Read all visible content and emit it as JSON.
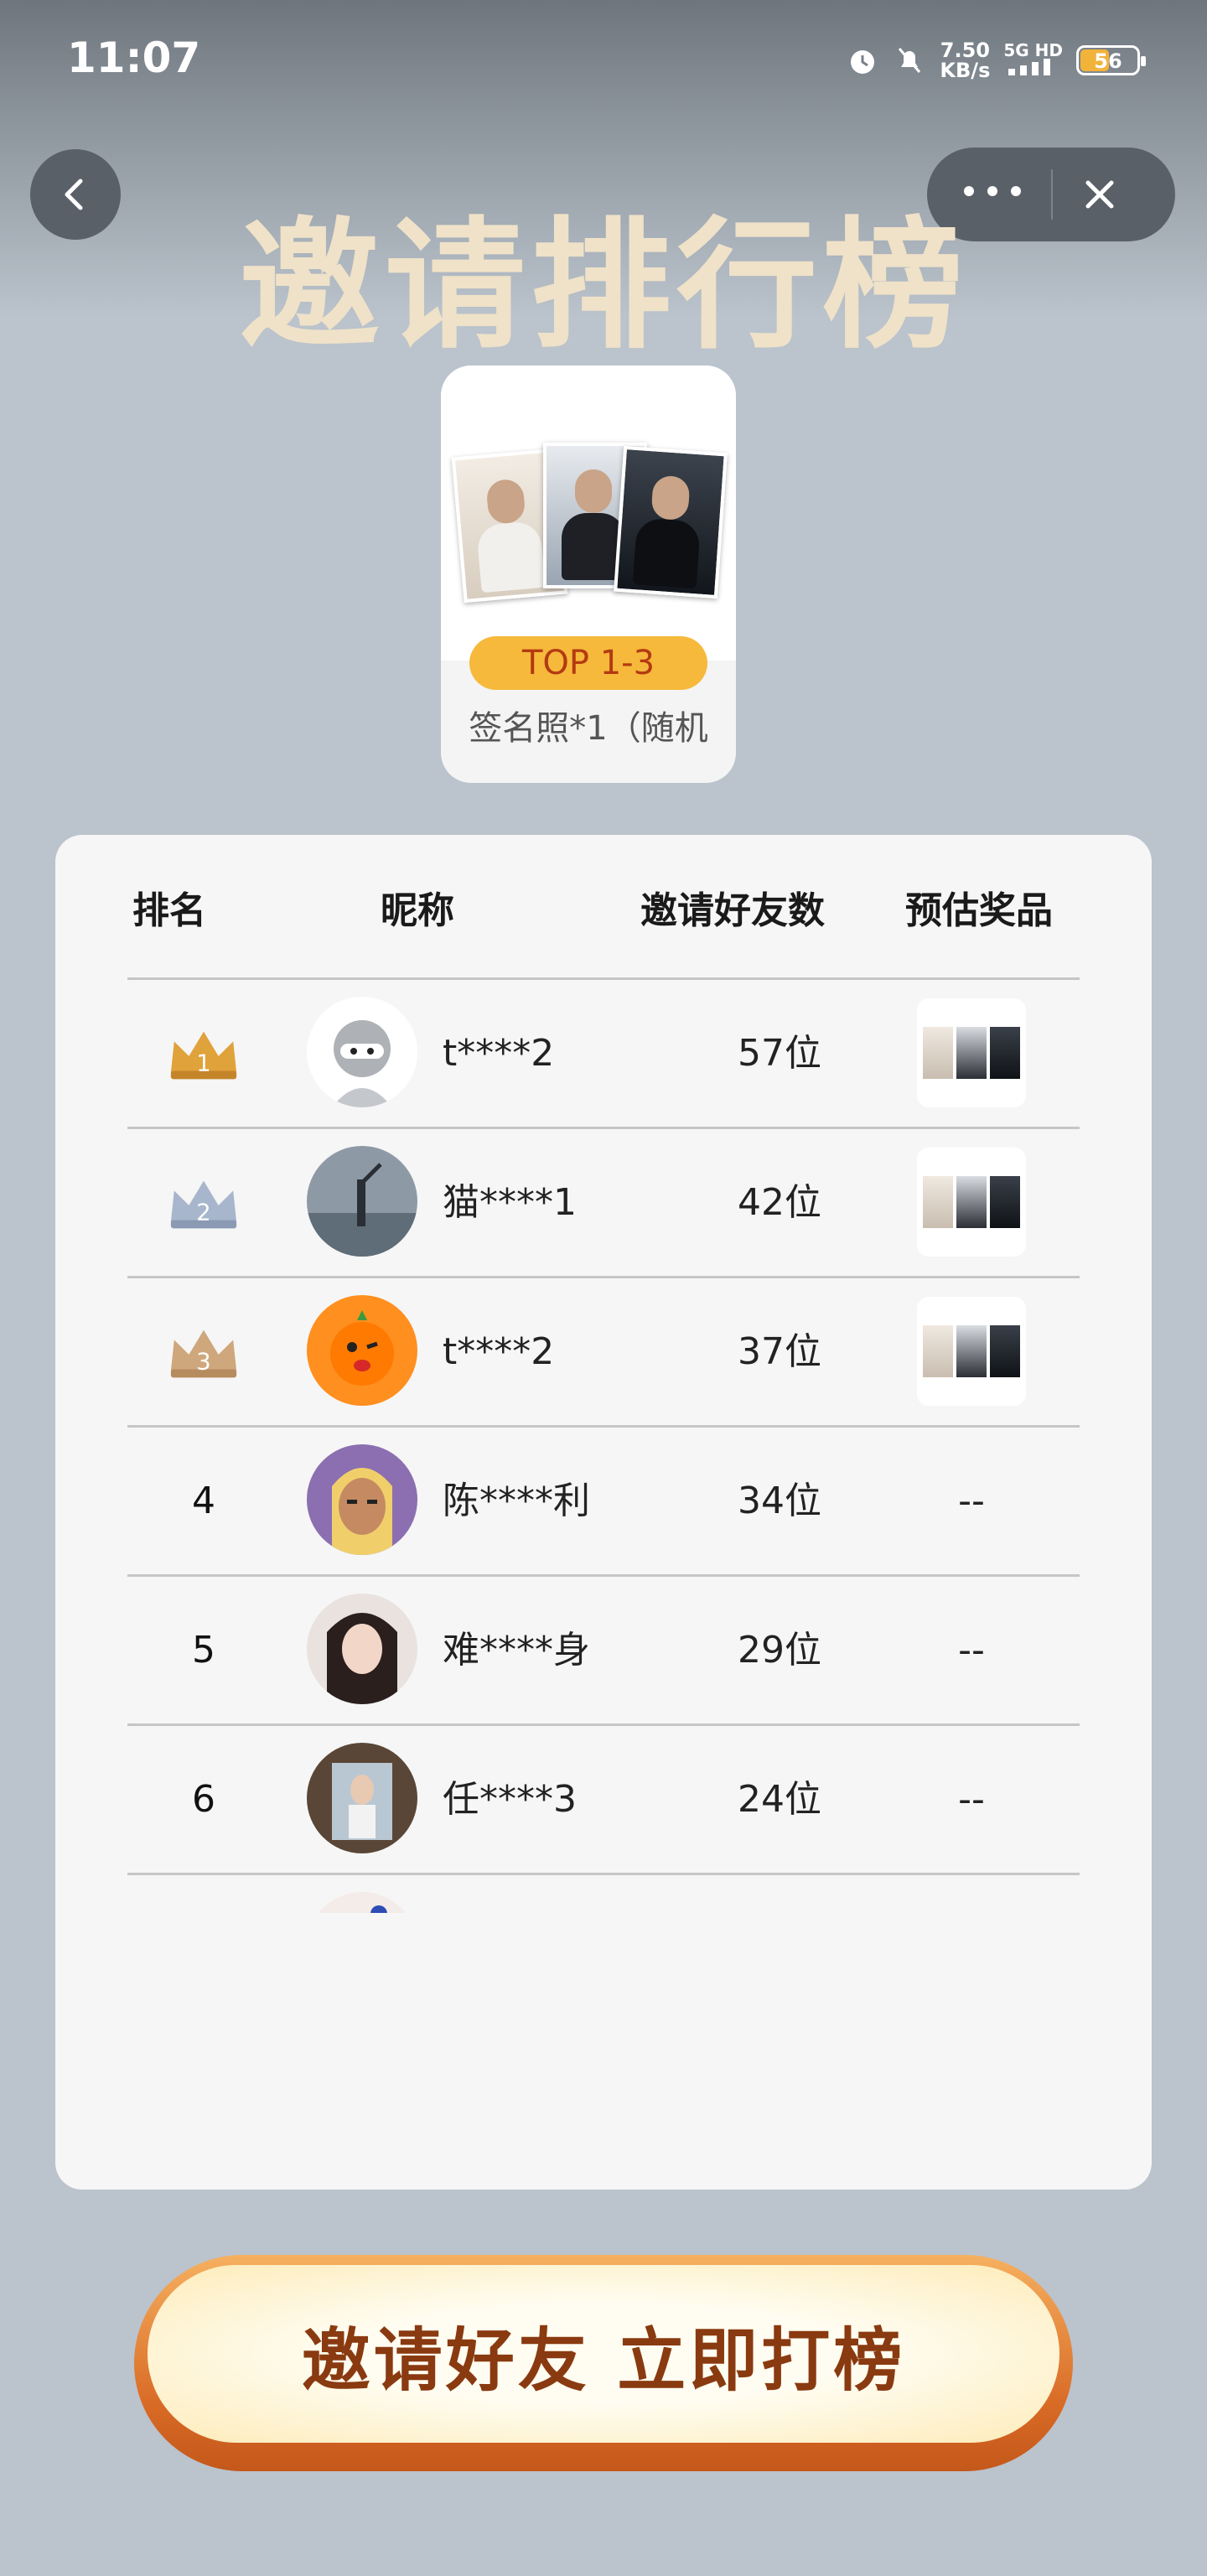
{
  "status_bar": {
    "time": "11:07",
    "net_speed_value": "7.50",
    "net_speed_unit": "KB/s",
    "network": "5G HD",
    "battery": "56"
  },
  "nav": {
    "back_icon": "chevron-left-icon",
    "more_icon": "more-dots-icon",
    "close_icon": "close-icon"
  },
  "page": {
    "title": "邀请排行榜"
  },
  "prize_card": {
    "badge": "TOP 1-3",
    "name": "签名照*1（随机"
  },
  "table": {
    "headers": {
      "rank": "排名",
      "nickname": "昵称",
      "invites": "邀请好友数",
      "prize": "预估奖品"
    },
    "rows": [
      {
        "rank": "1",
        "nickname": "t****2",
        "invites": "57位",
        "prize": "image",
        "crown": "gold",
        "avatar": "ninja-avatar"
      },
      {
        "rank": "2",
        "nickname": "猫****1",
        "invites": "42位",
        "prize": "image",
        "crown": "silver",
        "avatar": "beach-avatar"
      },
      {
        "rank": "3",
        "nickname": "t****2",
        "invites": "37位",
        "prize": "image",
        "crown": "bronze",
        "avatar": "orange-mascot-avatar"
      },
      {
        "rank": "4",
        "nickname": "陈****利",
        "invites": "34位",
        "prize": "--",
        "avatar": "cartoon-avatar"
      },
      {
        "rank": "5",
        "nickname": "难****身",
        "invites": "29位",
        "prize": "--",
        "avatar": "portrait-avatar"
      },
      {
        "rank": "6",
        "nickname": "任****3",
        "invites": "24位",
        "prize": "--",
        "avatar": "poster-avatar"
      }
    ]
  },
  "cta": {
    "label": "邀请好友 立即打榜"
  },
  "colors": {
    "background": "#bbc3cc",
    "title": "#efe2c8",
    "badge": "#f6b93b",
    "badge_text": "#b33a12",
    "cta_text": "#8a3a10"
  }
}
